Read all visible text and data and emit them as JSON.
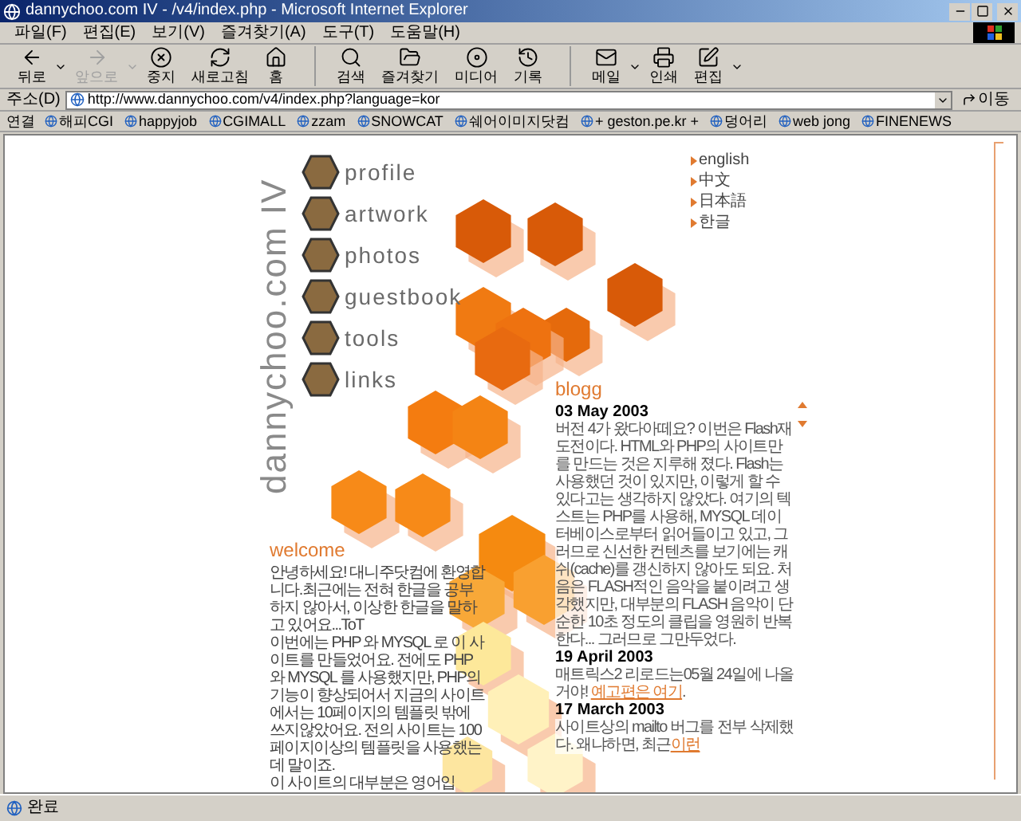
{
  "window": {
    "title": "dannychoo.com IV - /v4/index.php - Microsoft Internet Explorer"
  },
  "menu": [
    "파일(F)",
    "편집(E)",
    "보기(V)",
    "즐겨찾기(A)",
    "도구(T)",
    "도움말(H)"
  ],
  "toolbar": [
    {
      "kind": "back",
      "label": "뒤로",
      "disabled": false,
      "dropdown": true
    },
    {
      "kind": "forward",
      "label": "앞으로",
      "disabled": true,
      "dropdown": true
    },
    {
      "kind": "stop",
      "label": "중지",
      "disabled": false,
      "dropdown": false
    },
    {
      "kind": "refresh",
      "label": "새로고침",
      "disabled": false,
      "dropdown": false
    },
    {
      "kind": "home",
      "label": "홈",
      "disabled": false,
      "dropdown": false
    },
    {
      "kind": "search",
      "label": "검색",
      "disabled": false,
      "dropdown": false
    },
    {
      "kind": "favorites",
      "label": "즐겨찾기",
      "disabled": false,
      "dropdown": false
    },
    {
      "kind": "media",
      "label": "미디어",
      "disabled": false,
      "dropdown": false
    },
    {
      "kind": "history",
      "label": "기록",
      "disabled": false,
      "dropdown": false
    },
    {
      "kind": "mail",
      "label": "메일",
      "disabled": false,
      "dropdown": true
    },
    {
      "kind": "print",
      "label": "인쇄",
      "disabled": false,
      "dropdown": false
    },
    {
      "kind": "edit",
      "label": "편집",
      "disabled": false,
      "dropdown": true
    }
  ],
  "address": {
    "label": "주소(D)",
    "value": "http://www.dannychoo.com/v4/index.php?language=kor",
    "go": "이동"
  },
  "links": {
    "label": "연결",
    "items": [
      "해피CGI",
      "happyjob",
      "CGIMALL",
      "zzam",
      "SNOWCAT",
      "쉐어이미지닷컴",
      "+ geston.pe.kr +",
      "덩어리",
      "web jong",
      "FINENEWS"
    ]
  },
  "page": {
    "logo": "dannychoo.com IV",
    "nav": [
      "profile",
      "artwork",
      "photos",
      "guestbook",
      "tools",
      "links"
    ],
    "languages": [
      "english",
      "中文",
      "日本語",
      "한글"
    ],
    "welcome": {
      "title": "welcome",
      "paragraphs": [
        "안녕하세요! 대니주닷컴에 환영합니다.최근에는 전혀 한글을 공부하지 않아서, 이상한 한글을 말하고 있어요...ToT",
        "이번에는 PHP 와 MYSQL 로 이 사이트를 만들었어요. 전에도 PHP 와 MYSQL 를 사용했지만, PHP의 기능이 향상되어서 지금의 사이트에서는 10페이지의 템플릿 밖에 쓰지않았어요. 전의 사이트는 100페이지이상의 템플릿을 사용했는데 말이죠.",
        "이 사이트의 대부분은 영어입"
      ]
    },
    "blog": {
      "title": "blogg",
      "entries": [
        {
          "date": "03 May 2003",
          "parts": [
            {
              "kind": "text",
              "text": "버전 4가 왔다아떼요? 이번은 Flash재도전이다. HTML와 PHP의 사이트만를 만드는 것은 지루해 졌다. Flash는 사용했던 것이 있지만, 이렇게 할 수 있다고는 생각하지 않았다. 여기의 텍스트는 PHP를 사용해, MYSQL 데이터베이스로부터 읽어들이고 있고, 그러므로 신선한 컨텐츠를 보기에는 캐쉬(cache)를 갱신하지 않아도 되요. 처음은 FLASH적인 음악을 붙이려고 생각했지만, 대부분의 FLASH 음악이 단순한 10초 정도의 클립을 영원히 반복한다... 그러므로 그만두었다."
            }
          ]
        },
        {
          "date": "19 April 2003",
          "parts": [
            {
              "kind": "text",
              "text": "매트릭스2 리로드는05월 24일에 나올거야! "
            },
            {
              "kind": "link",
              "text": "예고편은 여기"
            },
            {
              "kind": "text",
              "text": "."
            }
          ]
        },
        {
          "date": "17 March 2003",
          "parts": [
            {
              "kind": "text",
              "text": "사이트상의 mailto 버그를 전부 삭제했다. 왜냐하면, 최근"
            },
            {
              "kind": "link",
              "text": "이런"
            }
          ]
        }
      ]
    }
  },
  "status_bar": {
    "text": "완료"
  }
}
